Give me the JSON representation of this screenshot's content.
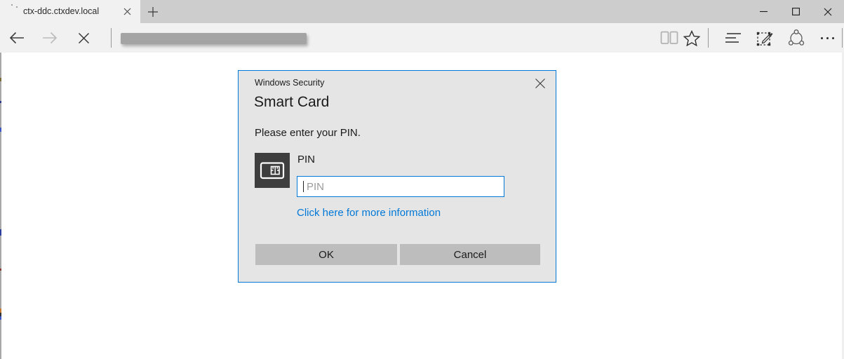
{
  "tab_bar": {
    "tabs": [
      {
        "title": "ctx-ddc.ctxdev.local",
        "active": true
      }
    ]
  },
  "toolbar": {
    "address_bar": {
      "value": ""
    }
  },
  "icons": {
    "tab_close": "x",
    "new_tab": "+",
    "minimize": "-",
    "maximize": "square",
    "window_close": "x",
    "back": "left-arrow",
    "forward": "right-arrow",
    "stop": "x",
    "reading_view": "open-book",
    "favorites": "star",
    "hub": "lines",
    "web_note": "pencil-in-dashed-box",
    "share": "circle-with-three-nodes",
    "more": "ellipsis",
    "dialog_close": "x",
    "smart_card": "card-with-chip"
  },
  "dialog": {
    "caption": "Windows Security",
    "title": "Smart Card",
    "message": "Please enter your PIN.",
    "pin_label": "PIN",
    "pin_placeholder": "PIN",
    "pin_value": "",
    "link_text": "Click here for more information",
    "buttons": {
      "ok": "OK",
      "cancel": "Cancel"
    }
  },
  "colors": {
    "accent_blue": "#0078d7",
    "dialog_background": "#e5e5e5",
    "tab_strip": "#cdcdcd",
    "toolbar": "#f1f1f1",
    "button_gray": "#bdbdbd",
    "card_icon_background": "#3e3e3e"
  }
}
